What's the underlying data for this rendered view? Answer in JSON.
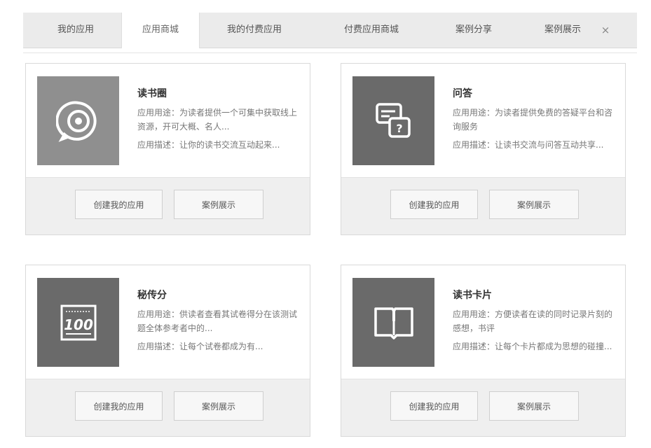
{
  "tabs": [
    {
      "label": "我的应用",
      "active": false
    },
    {
      "label": "应用商城",
      "active": true
    },
    {
      "label": "我的付费应用",
      "active": false
    },
    {
      "label": "付费应用商城",
      "active": false
    },
    {
      "label": "案例分享",
      "active": false
    },
    {
      "label": "案例展示",
      "active": false
    }
  ],
  "close_glyph": "×",
  "cards": [
    {
      "title": "读书圈",
      "use": "应用用途：为读者提供一个可集中获取线上资源，开可大概、名人...",
      "desc": "应用描述：让你的读书交流互动起来...",
      "icon": "chat-target-icon",
      "icon_color": "#8f8f8f",
      "create_label": "创建我的应用",
      "demo_label": "案例展示"
    },
    {
      "title": "问答",
      "use": "应用用途：为读者提供免费的答疑平台和咨询服务",
      "desc": "应用描述：让读书交流与问答互动共享...",
      "icon": "question-chat-icon",
      "icon_color": "#6a6a6a",
      "create_label": "创建我的应用",
      "demo_label": "案例展示"
    },
    {
      "title": "秘传分",
      "use": "应用用途：供读者查看其试卷得分在该测试题全体参考者中的...",
      "desc": "应用描述：让每个试卷都成为有...",
      "icon": "score-100-icon",
      "icon_color": "#6a6a6a",
      "create_label": "创建我的应用",
      "demo_label": "案例展示"
    },
    {
      "title": "读书卡片",
      "use": "应用用途：方便读者在读的同时记录片刻的感想，书评",
      "desc": "应用描述：让每个卡片都成为思想的碰撞...",
      "icon": "open-book-icon",
      "icon_color": "#6a6a6a",
      "create_label": "创建我的应用",
      "demo_label": "案例展示"
    }
  ]
}
